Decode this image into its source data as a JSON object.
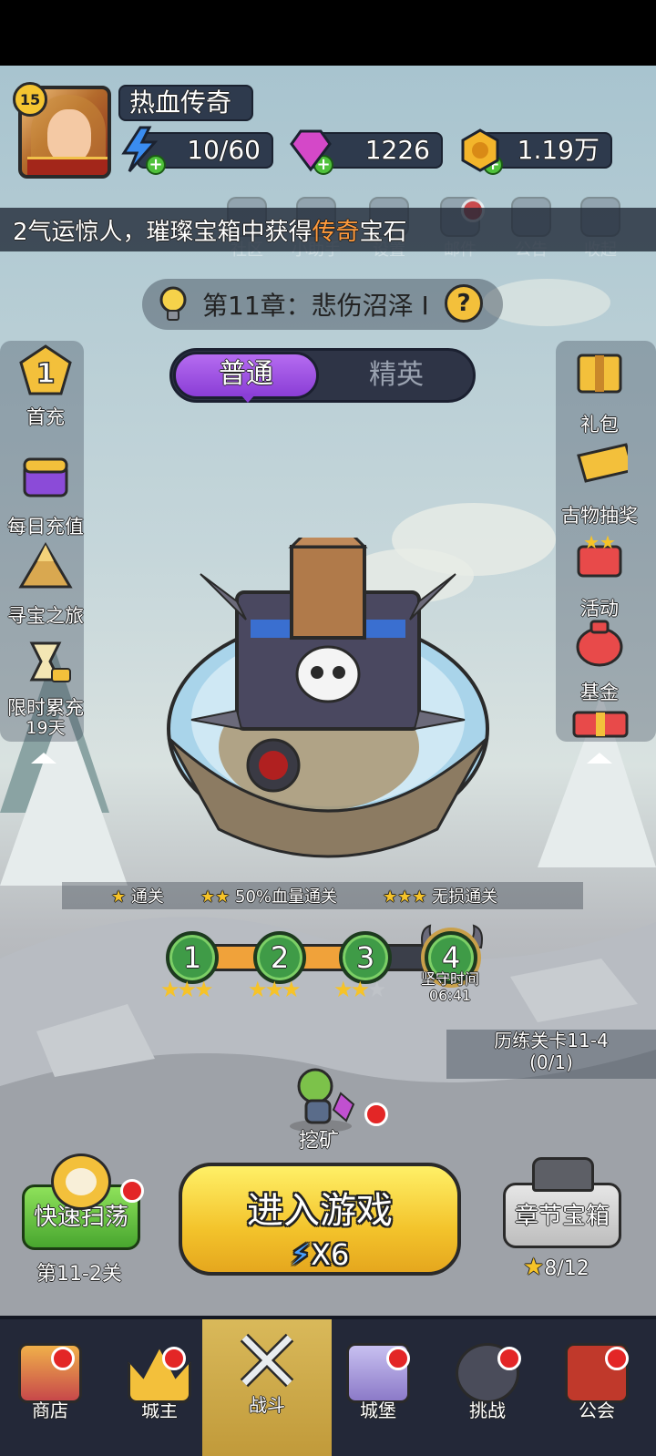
{
  "player": {
    "level": "15",
    "name": "热血传奇"
  },
  "resources": {
    "energy": "10/60",
    "gems": "1226",
    "gold": "1.19万"
  },
  "ticker": {
    "prefix": "2气运惊人，璀璨宝箱中获得",
    "highlight": "传奇",
    "suffix": "宝石"
  },
  "top_menu": [
    {
      "label": "社区",
      "icon": "community-icon"
    },
    {
      "label": "小助手",
      "icon": "helper-icon"
    },
    {
      "label": "设置",
      "icon": "settings-icon"
    },
    {
      "label": "邮件",
      "icon": "mail-icon"
    },
    {
      "label": "公告",
      "icon": "announcement-icon"
    },
    {
      "label": "收起",
      "icon": "collapse-icon"
    }
  ],
  "chapter": {
    "title": "第11章：悲伤沼泽 I"
  },
  "mode": {
    "normal": "普通",
    "elite": "精英",
    "selected": "普通"
  },
  "left_menu": [
    {
      "label": "首充",
      "icon": "first-recharge-icon",
      "badge": "1"
    },
    {
      "label": "每日充值",
      "icon": "daily-recharge-icon"
    },
    {
      "label": "寻宝之旅",
      "icon": "treasure-hunt-icon"
    },
    {
      "label": "限时累充",
      "sub": "19天",
      "icon": "limited-recharge-icon"
    }
  ],
  "right_menu": [
    {
      "label": "礼包",
      "icon": "gift-pack-icon"
    },
    {
      "label": "古物抽奖",
      "icon": "relic-lottery-icon"
    },
    {
      "label": "活动",
      "icon": "events-icon"
    },
    {
      "label": "基金",
      "icon": "fund-icon"
    }
  ],
  "star_conditions": [
    "通关",
    "50%血量通关",
    "无损通关"
  ],
  "stages": [
    {
      "num": "1",
      "stars": 3
    },
    {
      "num": "2",
      "stars": 3
    },
    {
      "num": "3",
      "stars": 2
    },
    {
      "num": "4",
      "label": "坚守时间",
      "timer": "06:41"
    }
  ],
  "trial": {
    "title": "历练关卡11-4",
    "progress": "(0/1)"
  },
  "mining": {
    "label": "挖矿"
  },
  "quick_sweep": {
    "label": "快速扫荡",
    "sub": "第11-2关"
  },
  "enter_game": {
    "label": "进入游戏",
    "cost": "X6"
  },
  "chapter_chest": {
    "label": "章节宝箱",
    "progress": "8/12"
  },
  "nav": [
    {
      "label": "商店",
      "icon": "shop-icon",
      "dot": true
    },
    {
      "label": "城主",
      "icon": "lord-icon",
      "dot": true
    },
    {
      "label": "战斗",
      "icon": "battle-icon",
      "active": true
    },
    {
      "label": "城堡",
      "icon": "castle-icon",
      "dot": true
    },
    {
      "label": "挑战",
      "icon": "challenge-icon",
      "dot": true
    },
    {
      "label": "公会",
      "icon": "guild-icon",
      "dot": true
    }
  ],
  "colors": {
    "accent_purple": "#8a3ed6",
    "button_yellow": "#f3c32b",
    "button_green": "#48a62f",
    "notify_red": "#e32626",
    "highlight_orange": "#ff9a3c"
  }
}
